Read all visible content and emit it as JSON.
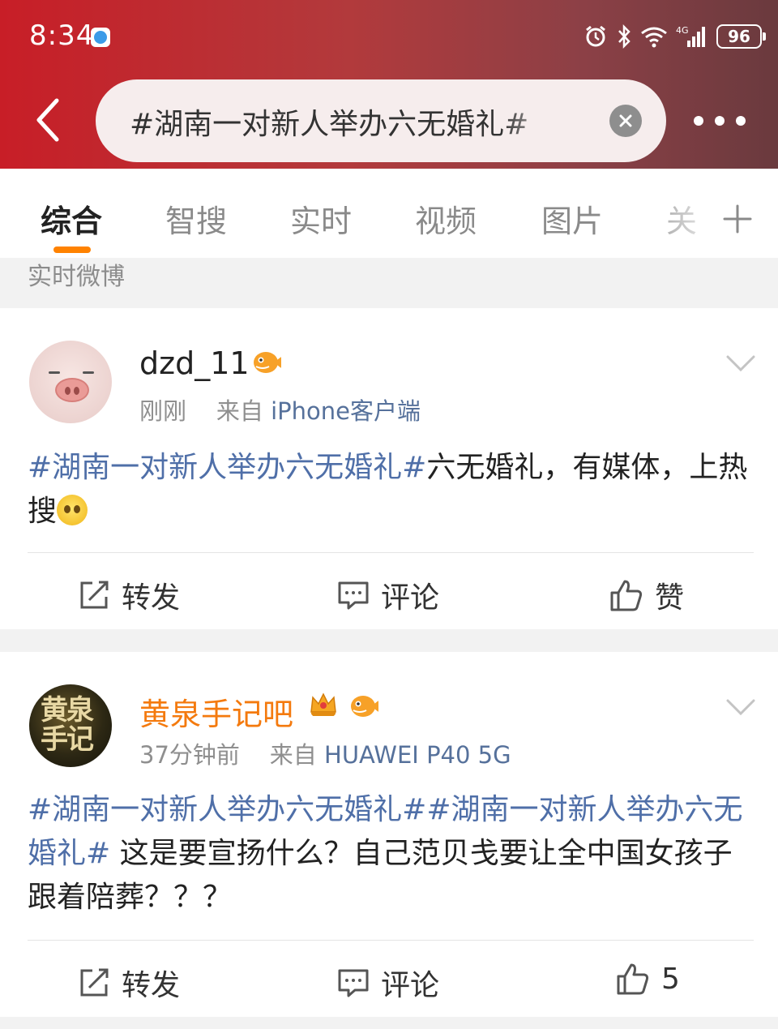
{
  "status_bar": {
    "time": "8:34",
    "battery": "96",
    "network": "4G"
  },
  "search": {
    "query": "#湖南一对新人举办六无婚礼#"
  },
  "tabs": [
    {
      "label": "综合"
    },
    {
      "label": "智搜"
    },
    {
      "label": "实时"
    },
    {
      "label": "视频"
    },
    {
      "label": "图片"
    },
    {
      "label": "关"
    }
  ],
  "section_label": "实时微博",
  "posts": [
    {
      "user": "dzd_11",
      "time": "刚刚",
      "source_prefix": "来自",
      "source": "iPhone客户端",
      "topic": "#湖南一对新人举办六无婚礼#",
      "text": "六无婚礼，有媒体，上热搜",
      "actions": {
        "repost": "转发",
        "comment": "评论",
        "like": "赞"
      }
    },
    {
      "user": "黄泉手记吧",
      "time": "37分钟前",
      "source_prefix": "来自",
      "source": "HUAWEI P40 5G",
      "topic": "#湖南一对新人举办六无婚礼##湖南一对新人举办六无婚礼#",
      "text": " 这是要宣扬什么？自己范贝戋要让全中国女孩子跟着陪葬？？？",
      "avatar_text": "黄泉手记",
      "actions": {
        "repost": "转发",
        "comment": "评论",
        "like": "5"
      }
    }
  ],
  "colors": {
    "header_start": "#c81e27",
    "header_end": "#6a3a3e",
    "active_tab_underline": "#ff8200",
    "topic_link": "#4f6fa8",
    "vip_name": "#f47a0e"
  }
}
